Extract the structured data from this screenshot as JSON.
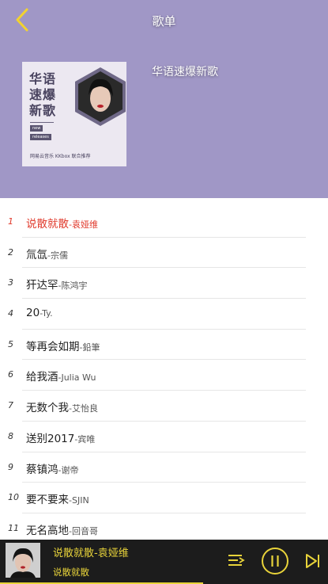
{
  "header": {
    "title": "歌单"
  },
  "playlist": {
    "name": "华语速爆新歌",
    "cover": {
      "lines": [
        "华语",
        "速爆",
        "新歌"
      ],
      "tag1": "new",
      "tag2": "releases",
      "footer": "网易云音乐 KKbox 联合推荐"
    }
  },
  "songs": [
    {
      "index": "1",
      "title": "说散就散",
      "artist": "-袁娅维"
    },
    {
      "index": "2",
      "title": "氚氙",
      "artist": "-宗儒"
    },
    {
      "index": "3",
      "title": "犴达罕",
      "artist": "-陈鸿宇"
    },
    {
      "index": "4",
      "title": "20",
      "artist": "-Ty."
    },
    {
      "index": "5",
      "title": "等再会如期",
      "artist": "-鉛筆"
    },
    {
      "index": "6",
      "title": "给我酒",
      "artist": "-Julia Wu"
    },
    {
      "index": "7",
      "title": "无数个我",
      "artist": "-艾怡良"
    },
    {
      "index": "8",
      "title": "送别2017",
      "artist": "-宾唯"
    },
    {
      "index": "9",
      "title": "蔡镇鸿",
      "artist": "-谢帝"
    },
    {
      "index": "10",
      "title": "要不要来",
      "artist": "-SJIN"
    },
    {
      "index": "11",
      "title": "无名高地",
      "artist": "-回音哥"
    }
  ],
  "player": {
    "title": "说散就散-袁娅维",
    "subtitle": "说散就散",
    "progress_fraction": 0.62
  },
  "colors": {
    "header_bg": "#a097c6",
    "active": "#e0392b",
    "accent": "#e8d33a",
    "player_bg": "#1c1c1c"
  },
  "icons": [
    "back-chevron-icon",
    "playlist-icon",
    "pause-icon",
    "next-icon"
  ]
}
